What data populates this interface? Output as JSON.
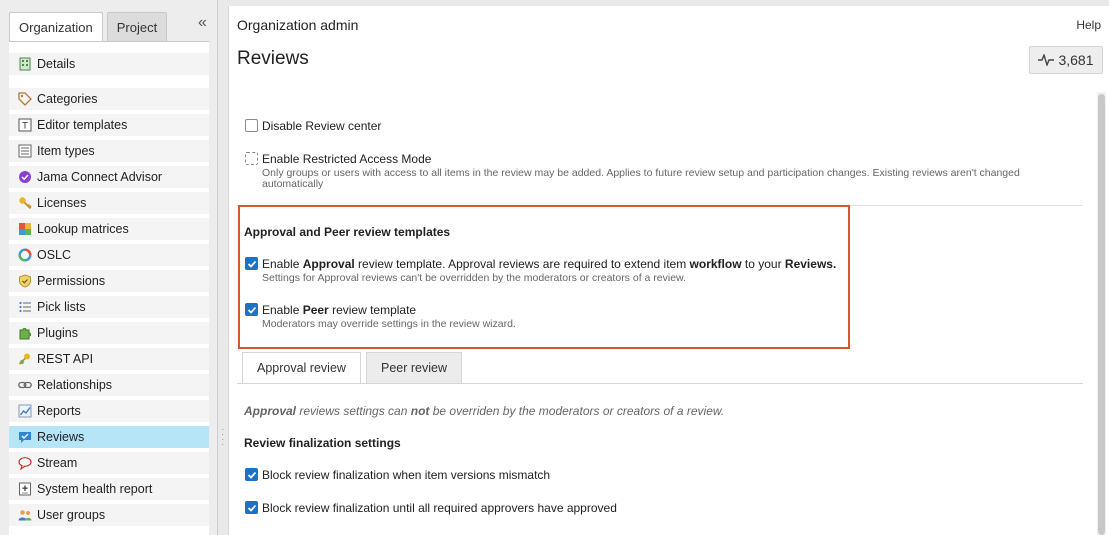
{
  "left_panel": {
    "tabs": [
      {
        "label": "Organization",
        "active": true
      },
      {
        "label": "Project",
        "active": false
      }
    ],
    "collapse_icon": "double-chevron-left",
    "nav_items": [
      {
        "label": "Details",
        "icon": "building-icon",
        "active": false
      },
      {
        "label": "Categories",
        "icon": "tag-icon",
        "active": false
      },
      {
        "label": "Editor templates",
        "icon": "template-icon",
        "active": false
      },
      {
        "label": "Item types",
        "icon": "list-icon",
        "active": false
      },
      {
        "label": "Jama Connect Advisor",
        "icon": "advisor-icon",
        "active": false
      },
      {
        "label": "Licenses",
        "icon": "key-icon",
        "active": false
      },
      {
        "label": "Lookup matrices",
        "icon": "matrix-icon",
        "active": false
      },
      {
        "label": "OSLC",
        "icon": "oslc-icon",
        "active": false
      },
      {
        "label": "Permissions",
        "icon": "shield-icon",
        "active": false
      },
      {
        "label": "Pick lists",
        "icon": "picklist-icon",
        "active": false
      },
      {
        "label": "Plugins",
        "icon": "puzzle-icon",
        "active": false
      },
      {
        "label": "REST API",
        "icon": "api-key-icon",
        "active": false
      },
      {
        "label": "Relationships",
        "icon": "chain-icon",
        "active": false
      },
      {
        "label": "Reports",
        "icon": "chart-icon",
        "active": false
      },
      {
        "label": "Reviews",
        "icon": "review-icon",
        "active": true
      },
      {
        "label": "Stream",
        "icon": "speech-icon",
        "active": false
      },
      {
        "label": "System health report",
        "icon": "health-icon",
        "active": false
      },
      {
        "label": "User groups",
        "icon": "users-icon",
        "active": false
      }
    ]
  },
  "main": {
    "title": "Organization admin",
    "help": "Help",
    "page_title": "Reviews",
    "stats_value": "3,681",
    "disable_review_center": {
      "label": "Disable Review center",
      "checked": false
    },
    "restricted_access": {
      "label": "Enable Restricted Access Mode",
      "checked": false,
      "help_line1": "Only groups or users with access to all items in the review may be added. Applies to future review setup and participation changes. Existing reviews aren't changed",
      "help_line2": "automatically"
    },
    "templates_section": {
      "heading": "Approval and Peer review templates",
      "approval": {
        "prefix": "Enable ",
        "bold1": "Approval",
        "middle": " review template. Approval reviews are required to extend item ",
        "bold2": "workflow",
        "middle2": " to your ",
        "bold3": "Reviews.",
        "help": "Settings for Approval reviews can't be overridden by the moderators or creators of a review.",
        "checked": true
      },
      "peer": {
        "prefix": "Enable ",
        "bold": "Peer",
        "suffix": " review template",
        "help": "Moderators may override settings in the review wizard.",
        "checked": true
      }
    },
    "review_tabs": [
      {
        "label": "Approval review",
        "active": true
      },
      {
        "label": "Peer review",
        "active": false
      }
    ],
    "approval_note": {
      "bold1": "Approval",
      "text1": " reviews settings can ",
      "bold2": "not",
      "text2": " be overriden by the moderators or creators of a review."
    },
    "finalization": {
      "heading": "Review finalization settings",
      "items": [
        {
          "label": "Block review finalization when item versions mismatch",
          "checked": true
        },
        {
          "label": "Block review finalization until all required approvers have approved",
          "checked": true
        }
      ]
    }
  },
  "colors": {
    "highlight_border": "#d8562c",
    "active_nav": "#b5e5f7",
    "checkbox_blue": "#1a73c9"
  }
}
